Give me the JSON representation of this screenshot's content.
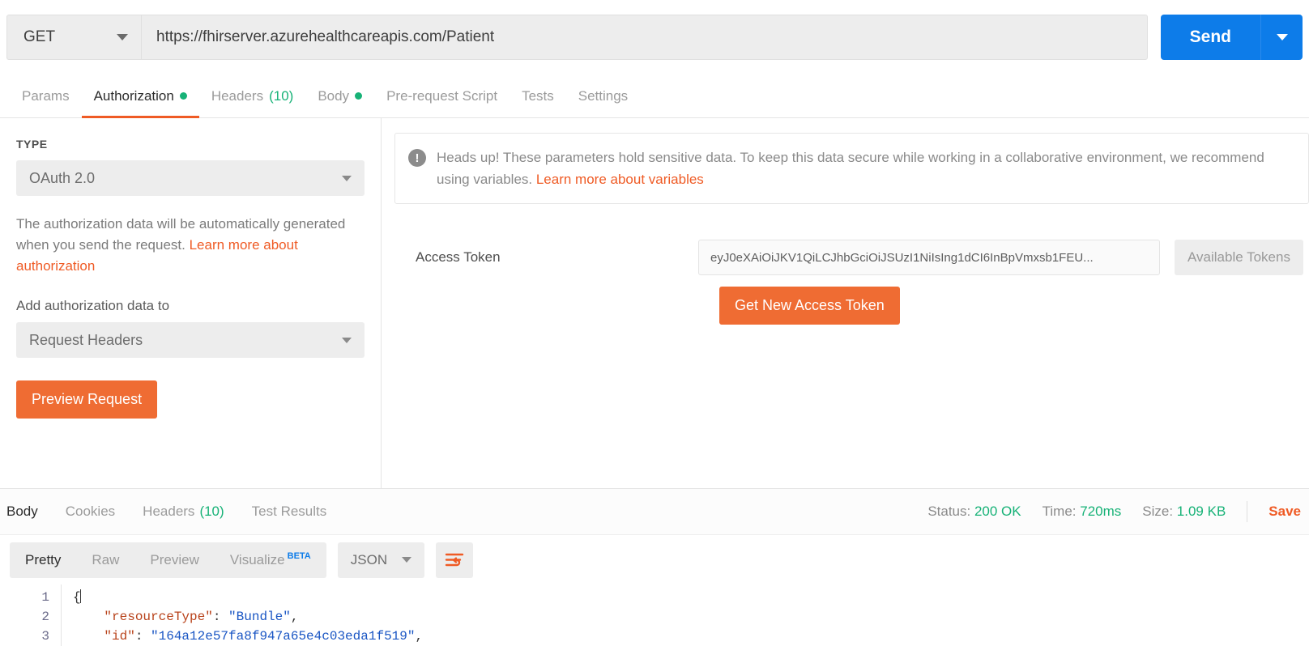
{
  "request": {
    "method": "GET",
    "url": "https://fhirserver.azurehealthcareapis.com/Patient",
    "send_label": "Send",
    "tabs": [
      {
        "label": "Params",
        "badge": "",
        "dot": false,
        "active": false
      },
      {
        "label": "Authorization",
        "badge": "",
        "dot": true,
        "active": true
      },
      {
        "label": "Headers",
        "badge": "(10)",
        "dot": false,
        "active": false
      },
      {
        "label": "Body",
        "badge": "",
        "dot": true,
        "active": false
      },
      {
        "label": "Pre-request Script",
        "badge": "",
        "dot": false,
        "active": false
      },
      {
        "label": "Tests",
        "badge": "",
        "dot": false,
        "active": false
      },
      {
        "label": "Settings",
        "badge": "",
        "dot": false,
        "active": false
      }
    ]
  },
  "auth": {
    "type_label": "TYPE",
    "type_value": "OAuth 2.0",
    "description_text": "The authorization data will be automatically generated when you send the request. ",
    "description_link": "Learn more about authorization",
    "add_data_label": "Add authorization data to",
    "add_data_value": "Request Headers",
    "preview_button": "Preview Request",
    "notice_text": "Heads up! These parameters hold sensitive data. To keep this data secure while working in a collaborative environment, we recommend using variables. ",
    "notice_link": "Learn more about variables",
    "access_token_label": "Access Token",
    "access_token_value": "eyJ0eXAiOiJKV1QiLCJhbGciOiJSUzI1NiIsIng1dCI6InBpVmxsb1FEU...",
    "available_tokens_label": "Available Tokens",
    "get_token_button": "Get New Access Token"
  },
  "response": {
    "tabs": [
      {
        "label": "Body",
        "badge": "",
        "active": true
      },
      {
        "label": "Cookies",
        "badge": "",
        "active": false
      },
      {
        "label": "Headers",
        "badge": "(10)",
        "active": false
      },
      {
        "label": "Test Results",
        "badge": "",
        "active": false
      }
    ],
    "status_label": "Status:",
    "status_value": "200 OK",
    "time_label": "Time:",
    "time_value": "720ms",
    "size_label": "Size:",
    "size_value": "1.09 KB",
    "save_label": "Save",
    "view_modes": [
      {
        "label": "Pretty",
        "active": true,
        "beta": ""
      },
      {
        "label": "Raw",
        "active": false,
        "beta": ""
      },
      {
        "label": "Preview",
        "active": false,
        "beta": ""
      },
      {
        "label": "Visualize",
        "active": false,
        "beta": "BETA"
      }
    ],
    "format": "JSON",
    "body_lines": [
      {
        "n": "1",
        "key": "",
        "value": "{",
        "trail": ""
      },
      {
        "n": "2",
        "key": "\"resourceType\"",
        "value": "\"Bundle\"",
        "trail": ","
      },
      {
        "n": "3",
        "key": "\"id\"",
        "value": "\"164a12e57fa8f947a65e4c03eda1f519\"",
        "trail": ","
      }
    ]
  },
  "colors": {
    "accent_orange": "#ef5b25",
    "send_blue": "#0d7ce9",
    "success_green": "#17b277"
  }
}
